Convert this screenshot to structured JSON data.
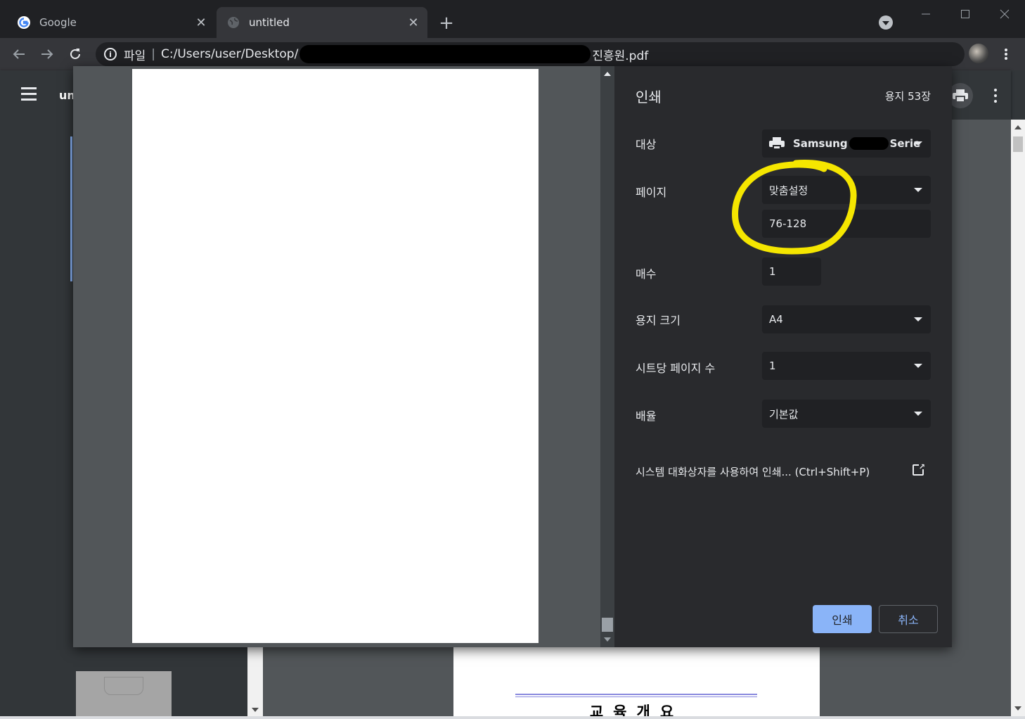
{
  "browser": {
    "tabs": [
      {
        "title": "Google",
        "close": "✕"
      },
      {
        "title": "untitled",
        "close": "✕"
      }
    ],
    "new_tab": "+",
    "omnibox": {
      "scheme_label": "파일",
      "separator": "|",
      "path_prefix": "C:/Users/user/Desktop/",
      "file_suffix": "진흥원.pdf"
    }
  },
  "pdf_viewer": {
    "title": "un",
    "document_heading": "교육개요"
  },
  "print": {
    "title": "인쇄",
    "sheet_count": "용지 53장",
    "destination": {
      "label": "대상",
      "printer_prefix": "Samsung",
      "printer_suffix": "Serie"
    },
    "pages": {
      "label": "페이지",
      "mode": "맞춤설정",
      "range": "76-128"
    },
    "copies": {
      "label": "매수",
      "value": "1"
    },
    "paper_size": {
      "label": "용지 크기",
      "value": "A4"
    },
    "pages_per_sheet": {
      "label": "시트당 페이지 수",
      "value": "1"
    },
    "scale": {
      "label": "배율",
      "value": "기본값"
    },
    "system_dialog": "시스템 대화상자를 사용하여 인쇄... (Ctrl+Shift+P)",
    "print_button": "인쇄",
    "cancel_button": "취소"
  },
  "colors": {
    "accent": "#8ab4f8",
    "highlight_annotation": "#f5e600",
    "dialog_bg": "#292a2d"
  }
}
